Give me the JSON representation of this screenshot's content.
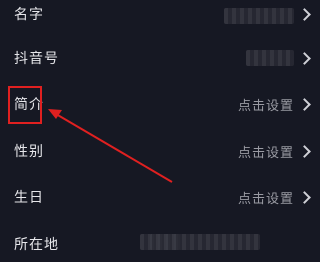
{
  "rows": [
    {
      "label": "名字",
      "value": "",
      "blurred": true
    },
    {
      "label": "抖音号",
      "value": "",
      "blurred": true
    },
    {
      "label": "简介",
      "value": "点击设置",
      "blurred": false
    },
    {
      "label": "性别",
      "value": "点击设置",
      "blurred": false
    },
    {
      "label": "生日",
      "value": "点击设置",
      "blurred": false
    },
    {
      "label": "所在地",
      "value": "",
      "blurred": true
    }
  ],
  "annotation": {
    "color": "#e02020",
    "highlighted_row": "简介"
  }
}
